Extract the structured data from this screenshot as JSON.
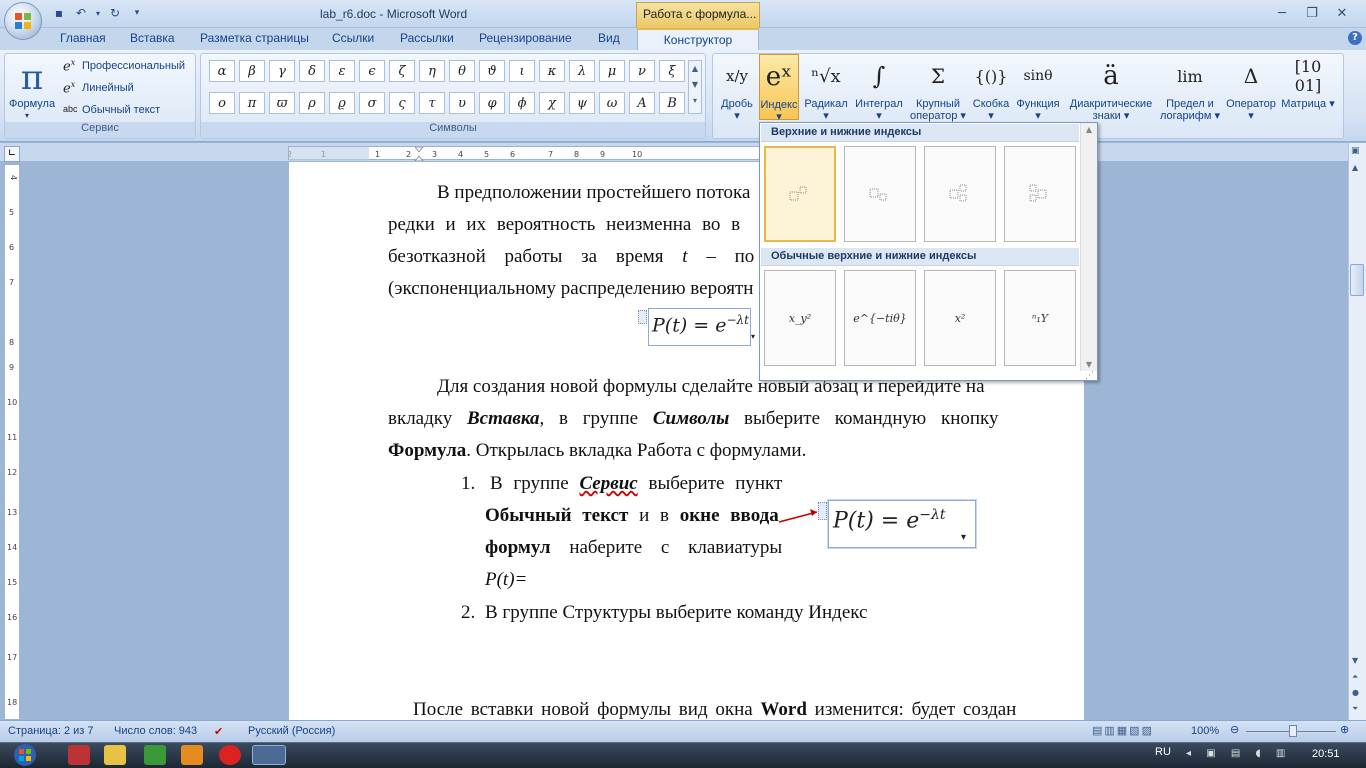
{
  "window": {
    "doc_title": "lab_r6.doc - Microsoft Word",
    "context_title": "Работа с формула..."
  },
  "tabs": [
    "Главная",
    "Вставка",
    "Разметка страницы",
    "Ссылки",
    "Рассылки",
    "Рецензирование",
    "Вид"
  ],
  "active_tab": "Конструктор",
  "ribbon": {
    "service": {
      "formula_label": "Формула",
      "pro_label": "Профессиональный",
      "linear_label": "Линейный",
      "plain_label": "Обычный текст",
      "group_label": "Сервис"
    },
    "symbols": {
      "row1": [
        "α",
        "β",
        "γ",
        "δ",
        "ε",
        "ϵ",
        "ζ",
        "η",
        "θ",
        "ϑ",
        "ι",
        "κ",
        "λ",
        "μ",
        "ν",
        "ξ"
      ],
      "row2": [
        "ο",
        "π",
        "ϖ",
        "ρ",
        "ϱ",
        "σ",
        "ς",
        "τ",
        "υ",
        "φ",
        "ϕ",
        "χ",
        "ψ",
        "ω",
        "Α",
        "Β"
      ],
      "group_label": "Символы"
    },
    "structures": [
      {
        "icon": "x/y",
        "label": "Дробь"
      },
      {
        "icon": "eˣ",
        "label": "Индекс"
      },
      {
        "icon": "ⁿ√x",
        "label": "Радикал"
      },
      {
        "icon": "∫",
        "label": "Интеграл"
      },
      {
        "icon": "Σ",
        "label": "Крупный оператор"
      },
      {
        "icon": "{()}",
        "label": "Скобка"
      },
      {
        "icon": "sinθ",
        "label": "Функция"
      },
      {
        "icon": "ä",
        "label": "Диакритические знаки"
      },
      {
        "icon": "lim",
        "label": "Предел и логарифм"
      },
      {
        "icon": "Δ",
        "label": "Оператор"
      },
      {
        "icon": "[10 01]",
        "label": "Матрица"
      }
    ]
  },
  "gallery": {
    "section1": "Верхние и нижние индексы",
    "section2": "Обычные верхние и нижние индексы",
    "common": [
      "x_y²",
      "e^{−tiθ}",
      "x²",
      "ⁿ₁Y"
    ]
  },
  "document": {
    "p1_l1": "В предположении простейшего потока",
    "p1_l2a": "редки и их вероятность неизменна во в",
    "p1_l3a": "безотказной работы за время",
    "p1_l3b": "t",
    "p1_l3c": "– по",
    "p1_l4": "(экспоненциальному распределению вероятн",
    "eq1": "P(t) = e",
    "eq1_sup": "−λt",
    "p2_l1": "Для создания новой формулы сделайте новый абзац и перейдите на",
    "p2_l2a": "вкладку",
    "p2_l2b": "Вставка",
    "p2_l2c": ", в группе",
    "p2_l2d": "Символы",
    "p2_l2e": "выберите командную кнопку",
    "p2_l3a": "Формула",
    "p2_l3b": ". Открылась вкладка Работа с формулами.",
    "li1_num": "1.",
    "li1_a": "В группе",
    "li1_b": "Сервис",
    "li1_c": "выберите пункт",
    "li1_l2a": "Обычный текст",
    "li1_l2b": "и в",
    "li1_l2c": "окне ввода",
    "li1_l3a": "формул",
    "li1_l3b": "наберите с клавиатуры",
    "li1_l4": "P(t)=",
    "li2_num": "2.",
    "li2": "В группе Структуры выберите команду Индекс",
    "p3_a": "После вставки новой формулы вид окна",
    "p3_b": "Word",
    "p3_c": "изменится: будет создан"
  },
  "status": {
    "page": "Страница: 2 из 7",
    "words": "Число слов: 943",
    "lang": "Русский (Россия)",
    "zoom": "100%"
  },
  "taskbar": {
    "lang": "RU",
    "time": "20:51"
  }
}
